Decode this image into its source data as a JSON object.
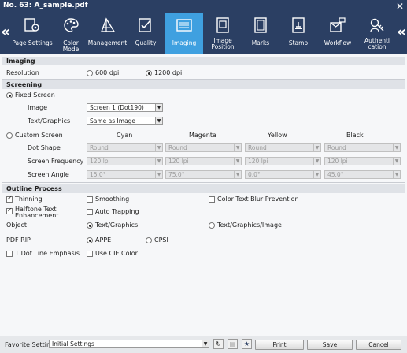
{
  "window": {
    "title": "No. 63: A_sample.pdf",
    "close_icon": "close-icon"
  },
  "toolbar": {
    "tabs": [
      {
        "label": "Page Settings",
        "icon": "page-settings-icon"
      },
      {
        "label": "Color Mode",
        "icon": "color-mode-icon"
      },
      {
        "label": "Management",
        "icon": "management-icon"
      },
      {
        "label": "Quality",
        "icon": "quality-icon"
      },
      {
        "label": "Imaging",
        "icon": "imaging-icon",
        "active": true
      },
      {
        "label": "Image",
        "label2": "Position",
        "icon": "image-position-icon"
      },
      {
        "label": "Marks",
        "icon": "marks-icon"
      },
      {
        "label": "Stamp",
        "icon": "stamp-icon"
      },
      {
        "label": "Workflow",
        "icon": "workflow-icon"
      },
      {
        "label": "Authenti",
        "label2": "cation",
        "icon": "authentication-icon"
      }
    ],
    "active_color": "#3fa0e0",
    "bar_color": "#2b3f63"
  },
  "imaging": {
    "header": "Imaging",
    "resolution_label": "Resolution",
    "res_600": "600 dpi",
    "res_1200": "1200 dpi",
    "res_selected": "1200 dpi"
  },
  "screening": {
    "header": "Screening",
    "fixed_screen": "Fixed Screen",
    "image_label": "Image",
    "image_value": "Screen 1 (Dot190)",
    "text_graphics_label": "Text/Graphics",
    "text_graphics_value": "Same as Image",
    "custom_screen": "Custom Screen",
    "columns": [
      "Cyan",
      "Magenta",
      "Yellow",
      "Black"
    ],
    "dot_shape_label": "Dot Shape",
    "dot_shape_values": [
      "Round",
      "Round",
      "Round",
      "Round"
    ],
    "frequency_label": "Screen Frequency",
    "frequency_values": [
      "120 lpi",
      "120 lpi",
      "120 lpi",
      "120 lpi"
    ],
    "angle_label": "Screen Angle",
    "angle_values": [
      "15.0°",
      "75.0°",
      "0.0°",
      "45.0°"
    ]
  },
  "outline": {
    "header": "Outline Process",
    "thinning": "Thinning",
    "smoothing": "Smoothing",
    "blur_prevention": "Color Text Blur Prevention",
    "halftone_line1": "Halftone Text",
    "halftone_line2": "Enhancement",
    "auto_trapping": "Auto Trapping",
    "object_label": "Object",
    "obj_text_graphics": "Text/Graphics",
    "obj_text_graphics_image": "Text/Graphics/Image"
  },
  "pdf_rip": {
    "label": "PDF RIP",
    "appe": "APPE",
    "cpsi": "CPSI",
    "dot_line": "1 Dot Line Emphasis",
    "cie": "Use CIE Color"
  },
  "footer": {
    "favorite_label": "Favorite Setting",
    "favorite_value": "Initial Settings",
    "print": "Print",
    "save": "Save",
    "cancel": "Cancel"
  }
}
